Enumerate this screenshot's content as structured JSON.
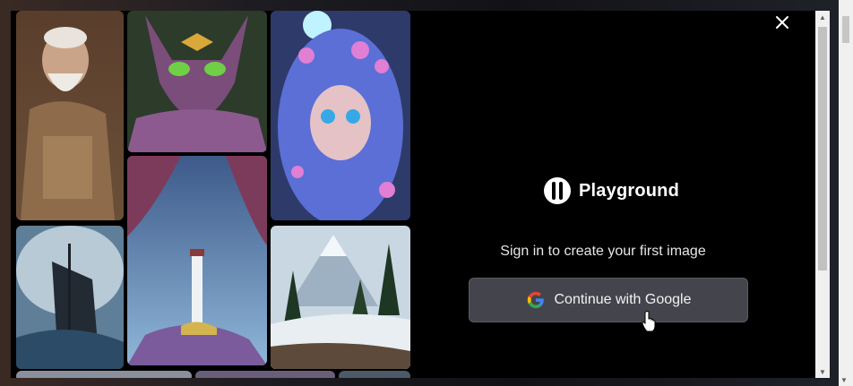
{
  "modal": {
    "close_icon": "close-icon",
    "brand": {
      "name": "Playground",
      "logo_icon": "playground-logo-icon"
    },
    "tagline": "Sign in to create your first image",
    "google_button": {
      "label": "Continue with Google",
      "icon": "google-g-icon"
    }
  },
  "gallery": {
    "tiles": [
      {
        "name": "old-man-portrait"
      },
      {
        "name": "ornate-cat"
      },
      {
        "name": "blue-haired-fairy"
      },
      {
        "name": "ship-in-storm"
      },
      {
        "name": "lighthouse-island"
      },
      {
        "name": "snowy-mountains"
      }
    ]
  },
  "colors": {
    "modal_bg": "#000000",
    "button_bg": "#44444c",
    "text": "#ffffff"
  }
}
